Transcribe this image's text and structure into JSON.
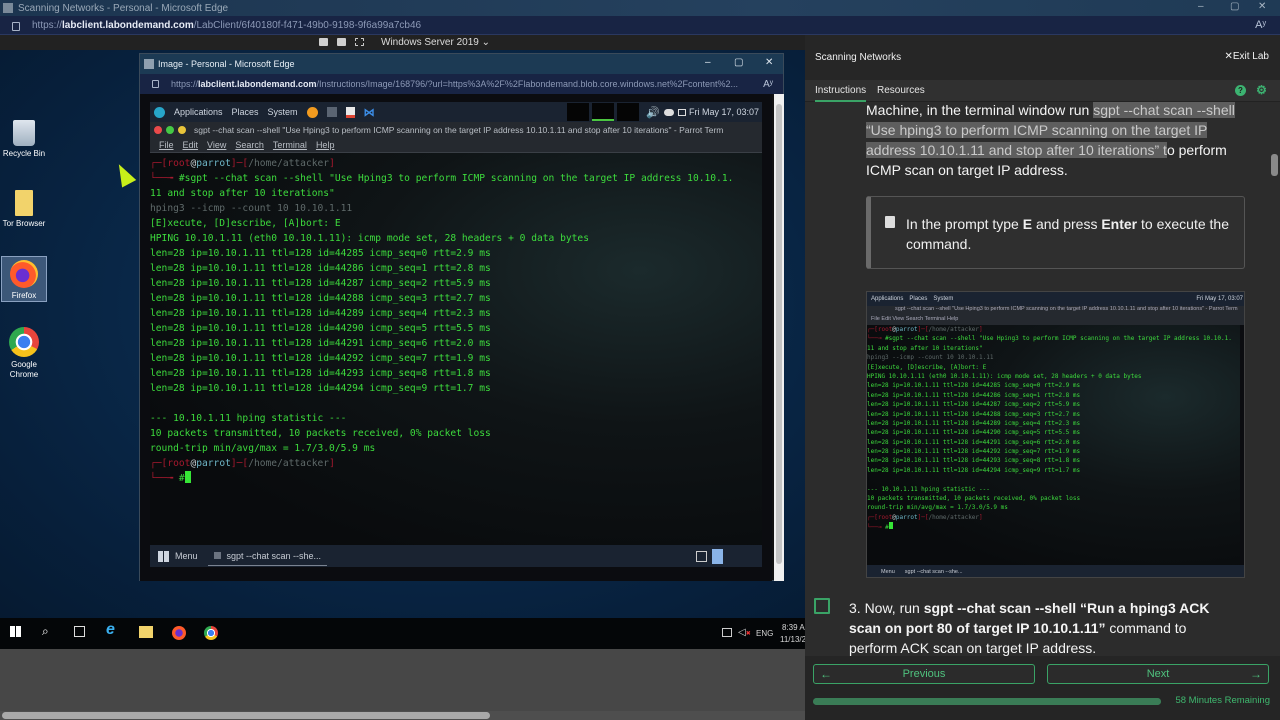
{
  "outer_window": {
    "title": "Scanning Networks - Personal - Microsoft Edge",
    "url_prefix": "https://",
    "url_domain": "labclient.labondemand.com",
    "url_path": "/LabClient/6f40180f-f471-49b0-9198-9f6a99a7cb46",
    "minimize": "–",
    "maximize": "▢",
    "close": "✕",
    "read_aloud": "Aʸ"
  },
  "vm_bar": {
    "vm_name": "Windows Server 2019 ⌄"
  },
  "desktop_icons": [
    {
      "label": "Recycle Bin",
      "icon": "recycle-bin-icon"
    },
    {
      "label": "Tor Browser",
      "icon": "folder-icon"
    },
    {
      "label": "Firefox",
      "icon": "firefox-icon",
      "selected": true
    },
    {
      "label": "Google Chrome",
      "icon": "chrome-icon"
    }
  ],
  "inner_window": {
    "title": "Image - Personal - Microsoft Edge",
    "url_prefix": "https://",
    "url_domain": "labclient.labondemand.com",
    "url_path": "/Instructions/Image/168796/?url=https%3A%2F%2Flabondemand.blob.core.windows.net%2Fcontent%2...",
    "minimize": "–",
    "maximize": "▢",
    "close": "✕",
    "read_aloud": "Aʸ"
  },
  "parrot": {
    "panel": {
      "applications": "Applications",
      "places": "Places",
      "system": "System",
      "clock": "Fri May 17, 03:07"
    },
    "terminal_title": "sgpt --chat scan --shell \"Use Hping3 to perform ICMP scanning on the target IP address 10.10.1.11 and stop after 10 iterations\" - Parrot Term",
    "menu": [
      "File",
      "Edit",
      "View",
      "Search",
      "Terminal",
      "Help"
    ],
    "prompt_user": "root",
    "prompt_host": "parrot",
    "prompt_path": "/home/attacker",
    "command_line1": "#sgpt --chat scan --shell \"Use Hping3 to perform ICMP scanning on the target IP address 10.10.1.",
    "command_line2": "11 and stop after 10 iterations\"",
    "suggested_command": "hping3 --icmp --count 10 10.10.1.11",
    "prompt_options": "[E]xecute, [D]escribe, [A]bort: E",
    "hping_header": "HPING 10.10.1.11 (eth0 10.10.1.11): icmp mode set, 28 headers + 0 data bytes",
    "replies": [
      "len=28 ip=10.10.1.11 ttl=128 id=44285 icmp_seq=0 rtt=2.9 ms",
      "len=28 ip=10.10.1.11 ttl=128 id=44286 icmp_seq=1 rtt=2.8 ms",
      "len=28 ip=10.10.1.11 ttl=128 id=44287 icmp_seq=2 rtt=5.9 ms",
      "len=28 ip=10.10.1.11 ttl=128 id=44288 icmp_seq=3 rtt=2.7 ms",
      "len=28 ip=10.10.1.11 ttl=128 id=44289 icmp_seq=4 rtt=2.3 ms",
      "len=28 ip=10.10.1.11 ttl=128 id=44290 icmp_seq=5 rtt=5.5 ms",
      "len=28 ip=10.10.1.11 ttl=128 id=44291 icmp_seq=6 rtt=2.0 ms",
      "len=28 ip=10.10.1.11 ttl=128 id=44292 icmp_seq=7 rtt=1.9 ms",
      "len=28 ip=10.10.1.11 ttl=128 id=44293 icmp_seq=8 rtt=1.8 ms",
      "len=28 ip=10.10.1.11 ttl=128 id=44294 icmp_seq=9 rtt=1.7 ms"
    ],
    "stat_header": "--- 10.10.1.11 hping statistic ---",
    "stat_packets": "10 packets transmitted, 10 packets received, 0% packet loss",
    "stat_rtt": "round-trip min/avg/max = 1.7/3.0/5.9 ms",
    "final_prompt_char": "#",
    "taskbar": {
      "menu": "Menu",
      "task": "sgpt --chat scan --she..."
    }
  },
  "win_taskbar": {
    "lang": "ENG",
    "time": "8:39 A",
    "date": "11/13/2"
  },
  "lab": {
    "title": "Scanning Networks",
    "exit": "Exit Lab",
    "tabs": [
      "Instructions",
      "Resources"
    ],
    "help_icon": "?",
    "para_lead": "Machine, in the terminal window run ",
    "para_cmd": "sgpt --chat scan --shell “Use hping3 to perform ICMP scanning on the target IP address 10.10.1.11 and stop after 10 iterations” t",
    "para_tail": "o perform ICMP scan on target IP address.",
    "note_pre": "In the prompt type ",
    "note_key1": "E",
    "note_mid": " and press ",
    "note_key2": "Enter",
    "note_post": " to execute the command.",
    "step3_num": "3. Now, run ",
    "step3_cmd": "sgpt --chat scan --shell “Run a hping3 ACK scan on port 80 of target IP 10.10.1.11”",
    "step3_tail": " command to perform ACK scan on target IP address.",
    "step3_checked": false,
    "previous": "Previous",
    "next": "Next",
    "remaining": "58 Minutes Remaining",
    "time_progress_percent": 100
  }
}
